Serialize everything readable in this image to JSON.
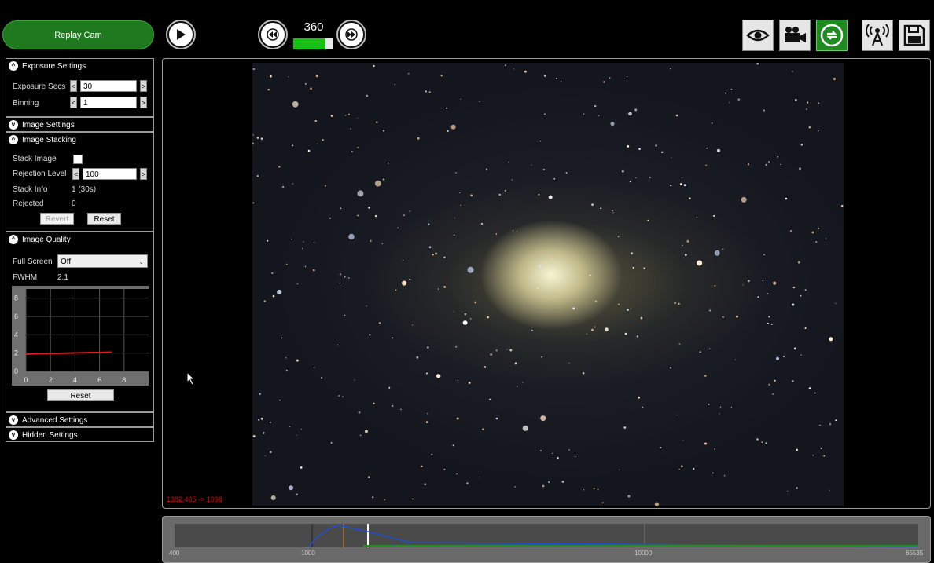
{
  "toolbar": {
    "replay_label": "Replay Cam",
    "frame_count": "360",
    "frame_progress": 0.8
  },
  "panels": {
    "exposure": {
      "title": "Exposure Settings",
      "exposure_label": "Exposure Secs",
      "exposure_value": "30",
      "binning_label": "Binning",
      "binning_value": "1"
    },
    "image_settings": {
      "title": "Image Settings"
    },
    "stacking": {
      "title": "Image Stacking",
      "stack_label": "Stack Image",
      "stack_checked": false,
      "rejection_label": "Rejection Level",
      "rejection_value": "100",
      "stack_info_label": "Stack Info",
      "stack_info_value": "1 (30s)",
      "rejected_label": "Rejected",
      "rejected_value": "0",
      "revert_label": "Revert",
      "reset_label": "Reset"
    },
    "quality": {
      "title": "Image Quality",
      "fullscreen_label": "Full Screen",
      "fullscreen_value": "Off",
      "fwhm_label": "FWHM",
      "fwhm_value": "2.1",
      "reset_label": "Reset"
    },
    "advanced": {
      "title": "Advanced Settings"
    },
    "hidden": {
      "title": "Hidden Settings"
    }
  },
  "fwhm_chart": {
    "type": "line",
    "x_ticks": [
      "0",
      "2",
      "4",
      "6",
      "8"
    ],
    "y_ticks": [
      "0",
      "2",
      "4",
      "6",
      "8"
    ],
    "xlim": [
      0,
      10
    ],
    "ylim": [
      0,
      9
    ],
    "series": [
      {
        "x": [
          0,
          7
        ],
        "y": [
          1.9,
          2.1
        ],
        "color": "#d02020"
      }
    ]
  },
  "viewer": {
    "coords": "1382,405 -> 1098"
  },
  "histogram": {
    "labels": [
      "400",
      "1000",
      "10000",
      "65535"
    ]
  },
  "colors": {
    "accent_green": "#1f7a1f",
    "frame_bar": "#16c016",
    "coords_text": "#d00000"
  }
}
